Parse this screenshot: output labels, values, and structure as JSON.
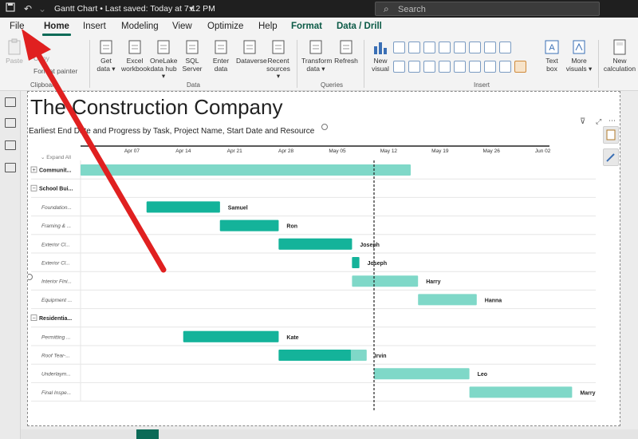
{
  "titlebar": {
    "doc_title": "Gantt Chart • Last saved: Today at 7:12 PM",
    "search_placeholder": "Search"
  },
  "menu": {
    "tabs": [
      "File",
      "Home",
      "Insert",
      "Modeling",
      "View",
      "Optimize",
      "Help",
      "Format",
      "Data / Drill"
    ],
    "active": "Home"
  },
  "ribbon": {
    "clipboard": {
      "paste": "Paste",
      "cut": "Cut",
      "copy": "Copy",
      "format_painter": "Format painter",
      "label": "Clipboard"
    },
    "data": {
      "buttons": [
        {
          "line1": "Get",
          "line2": "data ▾",
          "icon": "database-icon"
        },
        {
          "line1": "Excel",
          "line2": "workbook",
          "icon": "excel-icon"
        },
        {
          "line1": "OneLake",
          "line2": "data hub ▾",
          "icon": "onelake-icon"
        },
        {
          "line1": "SQL",
          "line2": "Server",
          "icon": "sql-server-icon"
        },
        {
          "line1": "Enter",
          "line2": "data",
          "icon": "table-icon"
        },
        {
          "line1": "Dataverse",
          "line2": "",
          "icon": "dataverse-icon"
        },
        {
          "line1": "Recent",
          "line2": "sources ▾",
          "icon": "recent-sources-icon"
        }
      ],
      "label": "Data"
    },
    "queries": {
      "buttons": [
        {
          "line1": "Transform",
          "line2": "data ▾",
          "icon": "transform-icon"
        },
        {
          "line1": "Refresh",
          "line2": "",
          "icon": "refresh-icon"
        }
      ],
      "label": "Queries"
    },
    "insert": {
      "new_visual": {
        "line1": "New",
        "line2": "visual"
      },
      "text_box": {
        "line1": "Text",
        "line2": "box"
      },
      "more_visuals": {
        "line1": "More",
        "line2": "visuals ▾"
      },
      "label": "Insert"
    },
    "calc": {
      "line1": "New",
      "line2": "calculation"
    }
  },
  "report": {
    "title": "The Construction Company",
    "visual_title": "Earliest End Date and Progress by Task, Project Name, Start Date and Resource"
  },
  "chart_data": {
    "type": "gantt",
    "expand_all_label": "Expand All",
    "date_ticks": [
      "Apr 07",
      "Apr 14",
      "Apr 21",
      "Apr 28",
      "May 05",
      "May 12",
      "May 19",
      "May 26",
      "Jun 02"
    ],
    "today_marker": "2024-05-10",
    "rows": [
      {
        "label": "Communit...",
        "group": true,
        "collapsed": true,
        "start": "2024-03-31",
        "end": "2024-05-15",
        "progress": 0,
        "resource": ""
      },
      {
        "label": "School Bui...",
        "group": true,
        "collapsed": false,
        "start": null,
        "end": null,
        "progress": null,
        "resource": ""
      },
      {
        "label": "Foundation...",
        "group": false,
        "start": "2024-04-09",
        "end": "2024-04-19",
        "progress": 1.0,
        "resource": "Samuel"
      },
      {
        "label": "Framing & ...",
        "group": false,
        "start": "2024-04-19",
        "end": "2024-04-27",
        "progress": 1.0,
        "resource": "Ron"
      },
      {
        "label": "Exterior Cl...",
        "group": false,
        "start": "2024-04-27",
        "end": "2024-05-07",
        "progress": 1.0,
        "resource": "Joseph"
      },
      {
        "label": "Exterior Cl...",
        "group": false,
        "start": "2024-05-07",
        "end": "2024-05-08",
        "progress": 1.0,
        "resource": "Joseph"
      },
      {
        "label": "Interior Fini...",
        "group": false,
        "start": "2024-05-07",
        "end": "2024-05-16",
        "progress": 0,
        "resource": "Harry"
      },
      {
        "label": "Equipment ...",
        "group": false,
        "start": "2024-05-16",
        "end": "2024-05-24",
        "progress": 0,
        "resource": "Hanna"
      },
      {
        "label": "Residentia...",
        "group": true,
        "collapsed": false,
        "start": null,
        "end": null,
        "progress": null,
        "resource": ""
      },
      {
        "label": "Permitting ...",
        "group": false,
        "start": "2024-04-14",
        "end": "2024-04-27",
        "progress": 1.0,
        "resource": "Kate"
      },
      {
        "label": "Roof Tear-...",
        "group": false,
        "start": "2024-04-27",
        "end": "2024-05-09",
        "progress": 0.82,
        "resource": "Irvin"
      },
      {
        "label": "Underlaym...",
        "group": false,
        "start": "2024-05-10",
        "end": "2024-05-23",
        "progress": 0,
        "resource": "Leo"
      },
      {
        "label": "Final Inspe...",
        "group": false,
        "start": "2024-05-23",
        "end": "2024-06-06",
        "progress": 0,
        "resource": "Marry"
      }
    ]
  },
  "annotation": {
    "arrow_color": "#e02020",
    "points_to": "File"
  },
  "colors": {
    "done": "#14b39a",
    "pending": "#7fd8c8",
    "accent": "#0b6a57"
  }
}
